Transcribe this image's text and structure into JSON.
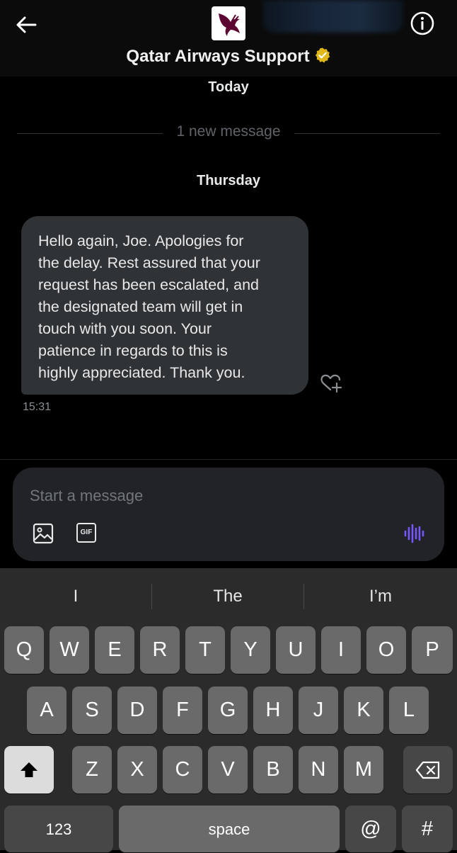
{
  "header": {
    "title": "Qatar Airways Support",
    "back_icon": "arrow-left-icon",
    "info_icon": "info-icon",
    "verified_icon": "verified-badge-icon",
    "logo": "qatar-airways-oryx-logo",
    "brand_color": "#5c0632",
    "verified_color": "#e2b719"
  },
  "conversation": {
    "today_label": "Today",
    "new_message_label": "1 new message",
    "day_label": "Thursday",
    "messages": [
      {
        "lines": [
          "Hello again, Joe. Apologies for",
          "the delay. Rest assured that your",
          "request has been escalated, and",
          "the designated team will get in",
          "touch with you soon. Your",
          "patience in regards to this is",
          "highly appreciated. Thank you."
        ],
        "time": "15:31",
        "react_icon": "heart-plus-icon"
      }
    ]
  },
  "composer": {
    "placeholder": "Start a message",
    "image_icon": "image-icon",
    "gif_label": "GIF",
    "voice_icon": "voice-wave-icon",
    "voice_color": "#7856ff"
  },
  "keyboard": {
    "suggestions": [
      "I",
      "The",
      "I’m"
    ],
    "row1": [
      "Q",
      "W",
      "E",
      "R",
      "T",
      "Y",
      "U",
      "I",
      "O",
      "P"
    ],
    "row2": [
      "A",
      "S",
      "D",
      "F",
      "G",
      "H",
      "J",
      "K",
      "L"
    ],
    "row3": [
      "Z",
      "X",
      "C",
      "V",
      "B",
      "N",
      "M"
    ],
    "shift_icon": "shift-arrow-icon",
    "delete_icon": "backspace-icon",
    "numbers_label": "123",
    "space_label": "space",
    "at_label": "@",
    "hash_label": "#"
  }
}
